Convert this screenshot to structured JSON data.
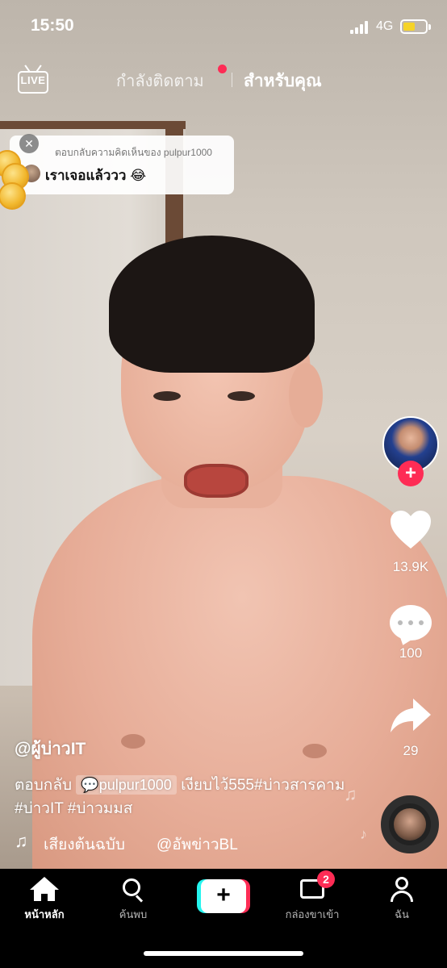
{
  "status_bar": {
    "time": "15:50",
    "network": "4G"
  },
  "top_nav": {
    "live_label": "LIVE",
    "tabs": [
      {
        "label": "กำลังติดตาม",
        "active": false,
        "has_dot": true
      },
      {
        "label": "สำหรับคุณ",
        "active": true
      }
    ]
  },
  "reply_card": {
    "label": "ตอบกลับความคิดเห็นของ pulpur1000",
    "comment": "เราเจอแล้ววว 😂"
  },
  "right_rail": {
    "likes": "13.9K",
    "comments": "100",
    "shares": "29"
  },
  "caption": {
    "username": "@ผู้บ่าวIT",
    "reply_prefix": "ตอบกลับ",
    "mention": "pulpur1000",
    "text": " เงียบไว้555#บ่าวสารคาม #บ่าวIT #บ่าวมมส"
  },
  "sound": {
    "title": "เสียงต้นฉบับ",
    "author": "@อัพข่าวBL"
  },
  "bottom_nav": {
    "items": [
      {
        "label": "หน้าหลัก",
        "active": true
      },
      {
        "label": "ค้นพบ",
        "active": false
      },
      {
        "label": "กล่องขาเข้า",
        "active": false,
        "badge": "2"
      },
      {
        "label": "ฉัน",
        "active": false
      }
    ]
  },
  "colors": {
    "accent": "#fe2c55",
    "create_cyan": "#25f4ee",
    "battery": "#f5d328"
  }
}
